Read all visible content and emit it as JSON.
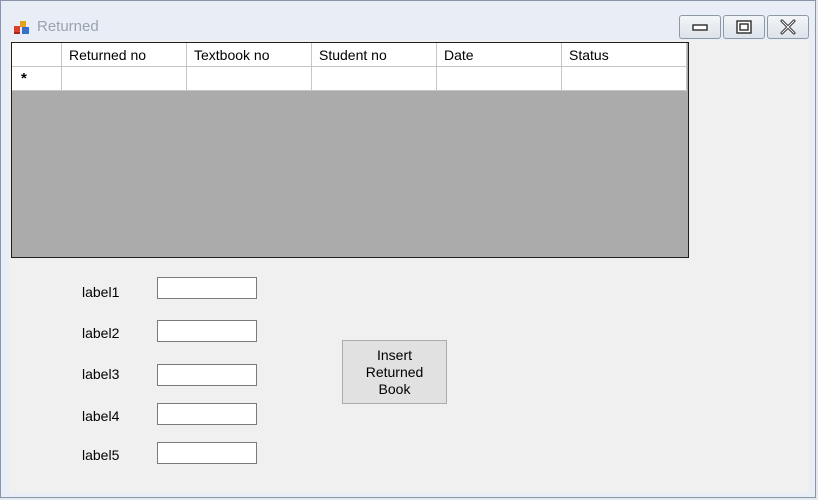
{
  "window": {
    "title": "Returned",
    "controls": {
      "minimize": "minimize-icon",
      "maximize": "maximize-icon",
      "close": "close-icon"
    }
  },
  "grid": {
    "columns": [
      "Returned no",
      "Textbook no",
      "Student no",
      "Date",
      "Status"
    ],
    "new_row_marker": "*",
    "background": "#ababab"
  },
  "form": {
    "labels": [
      "label1",
      "label2",
      "label3",
      "label4",
      "label5"
    ],
    "values": [
      "",
      "",
      "",
      "",
      ""
    ]
  },
  "insert_button": {
    "label": "Insert Returned Book"
  }
}
